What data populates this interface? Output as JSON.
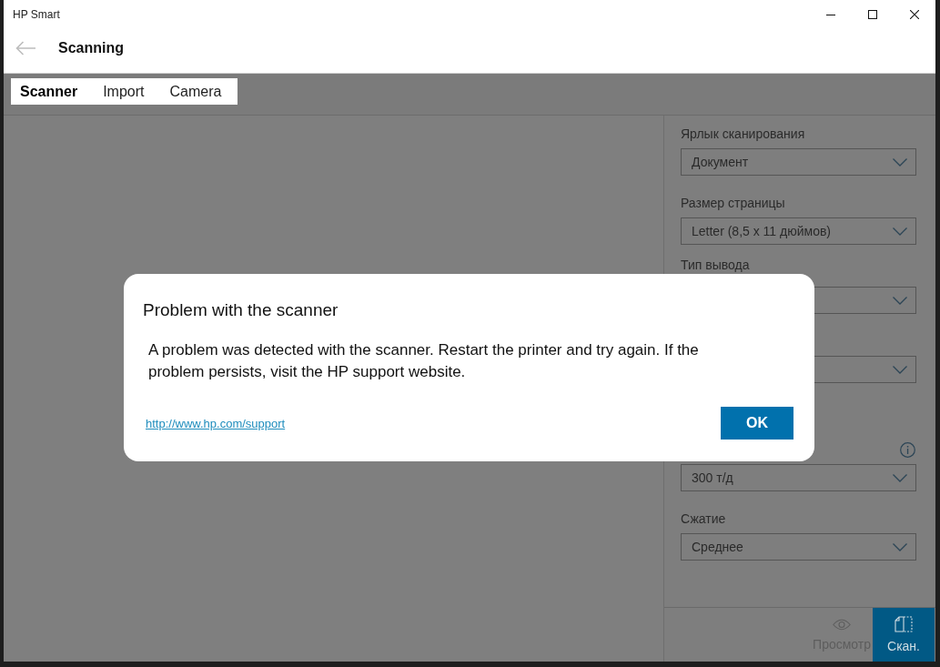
{
  "window": {
    "title": "HP Smart"
  },
  "header": {
    "title": "Scanning"
  },
  "tabs": [
    {
      "label": "Scanner",
      "selected": true
    },
    {
      "label": "Import",
      "selected": false
    },
    {
      "label": "Camera",
      "selected": false
    }
  ],
  "settings": [
    {
      "kind": "dropdown",
      "label": "Ярлык сканирования",
      "value": "Документ",
      "info": false
    },
    {
      "kind": "dropdown",
      "label": "Размер страницы",
      "value": "Letter (8,5 x 11 дюймов)",
      "info": false
    },
    {
      "kind": "dropdown",
      "label": "Тип вывода",
      "info": false
    },
    {
      "kind": "dropdown",
      "info": false
    },
    {
      "kind": "dropdown",
      "value": "300 т/д",
      "info": true
    },
    {
      "kind": "dropdown",
      "label": "Сжатие",
      "value": "Среднее",
      "info": false
    }
  ],
  "actions": [
    {
      "kind": "preview",
      "label": "Просмотр",
      "disabled": true
    },
    {
      "kind": "scan",
      "label": "Скан.",
      "disabled": false
    }
  ],
  "dialog": {
    "title": "Problem with the scanner",
    "message": "A problem was detected with the scanner. Restart the printer and try again. If the problem persists, visit the HP support website.",
    "link": "http://www.hp.com/support",
    "button": "OK"
  }
}
